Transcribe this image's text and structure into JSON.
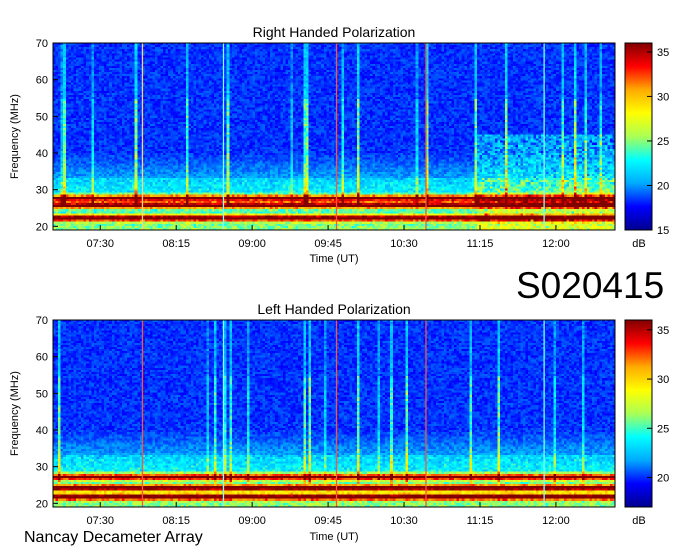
{
  "station_id": "S020415",
  "instrument": "Nancay Decameter Array",
  "chart_data": [
    {
      "type": "heatmap",
      "title": "Right Handed Polarization",
      "xlabel": "Time (UT)",
      "ylabel": "Frequency (MHz)",
      "x_ticks": [
        "07:30",
        "08:15",
        "09:00",
        "09:45",
        "10:30",
        "11:15",
        "12:00"
      ],
      "y_ticks": [
        "20",
        "30",
        "40",
        "50",
        "60",
        "70"
      ],
      "ylim": [
        19,
        70
      ],
      "colorbar_ticks": [
        "15",
        "20",
        "25",
        "30",
        "35"
      ],
      "colorbar_unit": "dB",
      "colorbar_range": [
        15,
        36
      ],
      "colormap": [
        "#00008f",
        "#0000ff",
        "#00aaff",
        "#00ffff",
        "#aaff55",
        "#ffff00",
        "#ffaa00",
        "#ff0000",
        "#800000"
      ],
      "features": {
        "strong_bands_mhz": [
          22,
          25.5,
          27.5
        ],
        "sweep_markers": [
          {
            "time": "07:55",
            "color": "#ffd080"
          },
          {
            "time": "08:43",
            "color": "#80ffff"
          },
          {
            "time": "09:50",
            "color": "#ff5040"
          },
          {
            "time": "10:43",
            "color": "#ff5040"
          },
          {
            "time": "11:53",
            "color": "#80ffff"
          }
        ]
      }
    },
    {
      "type": "heatmap",
      "title": "Left Handed Polarization",
      "xlabel": "Time (UT)",
      "ylabel": "Frequency (MHz)",
      "x_ticks": [
        "07:30",
        "08:15",
        "09:00",
        "09:45",
        "10:30",
        "11:15",
        "12:00"
      ],
      "y_ticks": [
        "20",
        "30",
        "40",
        "50",
        "60",
        "70"
      ],
      "ylim": [
        19,
        70
      ],
      "colorbar_ticks": [
        "20",
        "25",
        "30",
        "35"
      ],
      "colorbar_unit": "dB",
      "colorbar_range": [
        17,
        36
      ],
      "colormap": [
        "#00008f",
        "#0000ff",
        "#00aaff",
        "#00ffff",
        "#aaff55",
        "#ffff00",
        "#ffaa00",
        "#ff0000",
        "#800000"
      ],
      "features": {
        "strong_bands_mhz": [
          21.5,
          24,
          27
        ],
        "sweep_markers": [
          {
            "time": "07:55",
            "color": "#ff5040"
          },
          {
            "time": "08:43",
            "color": "#80ffff"
          },
          {
            "time": "09:50",
            "color": "#ff5040"
          },
          {
            "time": "10:43",
            "color": "#ff5040"
          },
          {
            "time": "11:53",
            "color": "#80ffff"
          }
        ]
      }
    }
  ]
}
